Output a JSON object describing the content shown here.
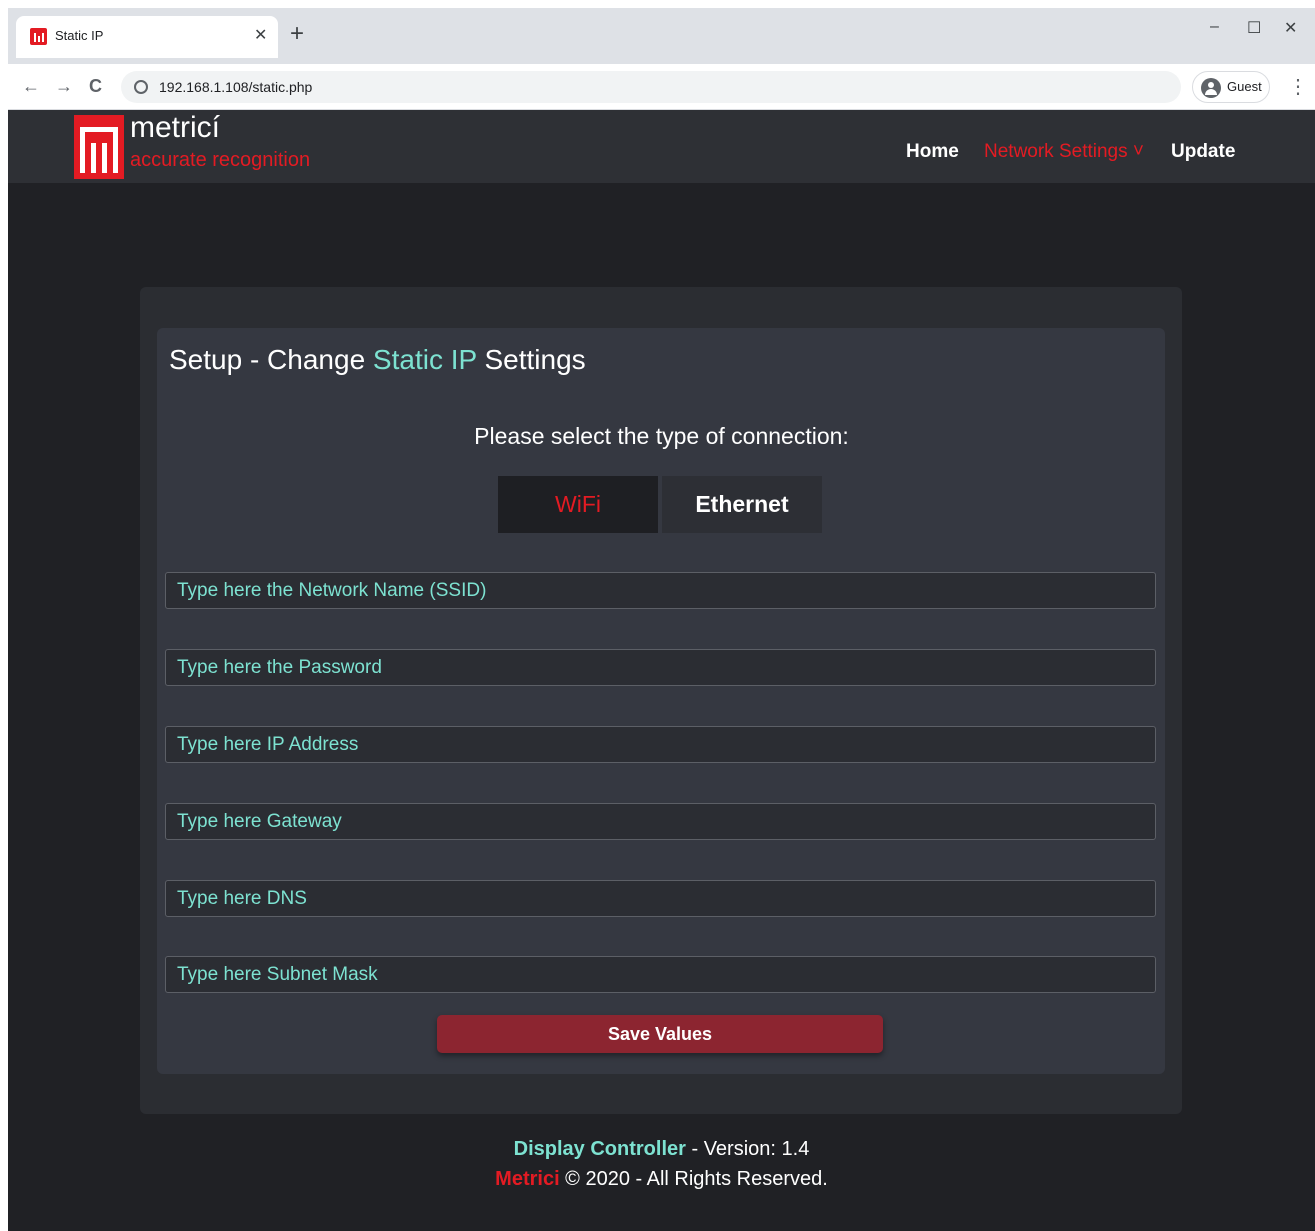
{
  "browser": {
    "tab_title": "Static IP",
    "tab_close": "✕",
    "new_tab": "+",
    "minimize": "–",
    "maximize": "☐",
    "close": "✕",
    "back": "←",
    "forward": "→",
    "reload": "C",
    "url": "192.168.1.108/static.php",
    "profile_label": "Guest",
    "menu": "⋮"
  },
  "header": {
    "brand_name": "metricí",
    "brand_tagline": "accurate recognition",
    "nav": {
      "home": "Home",
      "network_settings": "Network Settings ˅",
      "update": "Update"
    }
  },
  "form": {
    "title_prefix": "Setup - Change ",
    "title_accent": "Static IP",
    "title_suffix": " Settings",
    "prompt": "Please select the type of connection:",
    "segments": {
      "wifi": "WiFi",
      "ethernet": "Ethernet"
    },
    "fields": {
      "ssid": "Type here the Network Name (SSID)",
      "password": "Type here the Password",
      "ip": "Type here IP Address",
      "gateway": "Type here Gateway",
      "dns": "Type here DNS",
      "subnet": "Type here Subnet Mask"
    },
    "save_label": "Save Values"
  },
  "footer": {
    "product": "Display Controller",
    "version_text": " - Version: 1.4",
    "brand": "Metrici",
    "rights": " © 2020 - All Rights Reserved."
  },
  "colors": {
    "brand_red": "#e31b23",
    "accent_teal": "#7de2d1",
    "button_red": "#8c2530"
  }
}
